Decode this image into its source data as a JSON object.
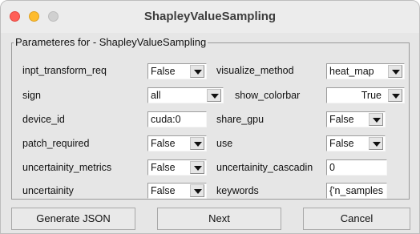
{
  "window": {
    "title": "ShapleyValueSampling"
  },
  "group": {
    "legend": "Parameteres for - ShapleyValueSampling"
  },
  "params": {
    "inpt_transform_req": {
      "label": "inpt_transform_req",
      "value": "False"
    },
    "visualize_method": {
      "label": "visualize_method",
      "value": "heat_map"
    },
    "sign": {
      "label": "sign",
      "value": "all"
    },
    "show_colorbar": {
      "label": "show_colorbar",
      "value": "True"
    },
    "device_id": {
      "label": "device_id",
      "value": "cuda:0"
    },
    "share_gpu": {
      "label": "share_gpu",
      "value": "False"
    },
    "patch_required": {
      "label": "patch_required",
      "value": "False"
    },
    "use": {
      "label": "use",
      "value": "False"
    },
    "uncertainity_metrics": {
      "label": "uncertainity_metrics",
      "value": "False"
    },
    "uncertainity_cascading": {
      "label": "uncertainity_cascadin",
      "value": "0"
    },
    "uncertainity": {
      "label": "uncertainity",
      "value": "False"
    },
    "keywords": {
      "label": "keywords",
      "value": "{'n_samples"
    }
  },
  "buttons": {
    "generate_json": "Generate JSON",
    "next": "Next",
    "cancel": "Cancel"
  },
  "colors": {
    "close": "#ff5f57",
    "minimize": "#febc2e",
    "maximize": "#d0d0d0",
    "window_bg": "#e6e6e6"
  }
}
